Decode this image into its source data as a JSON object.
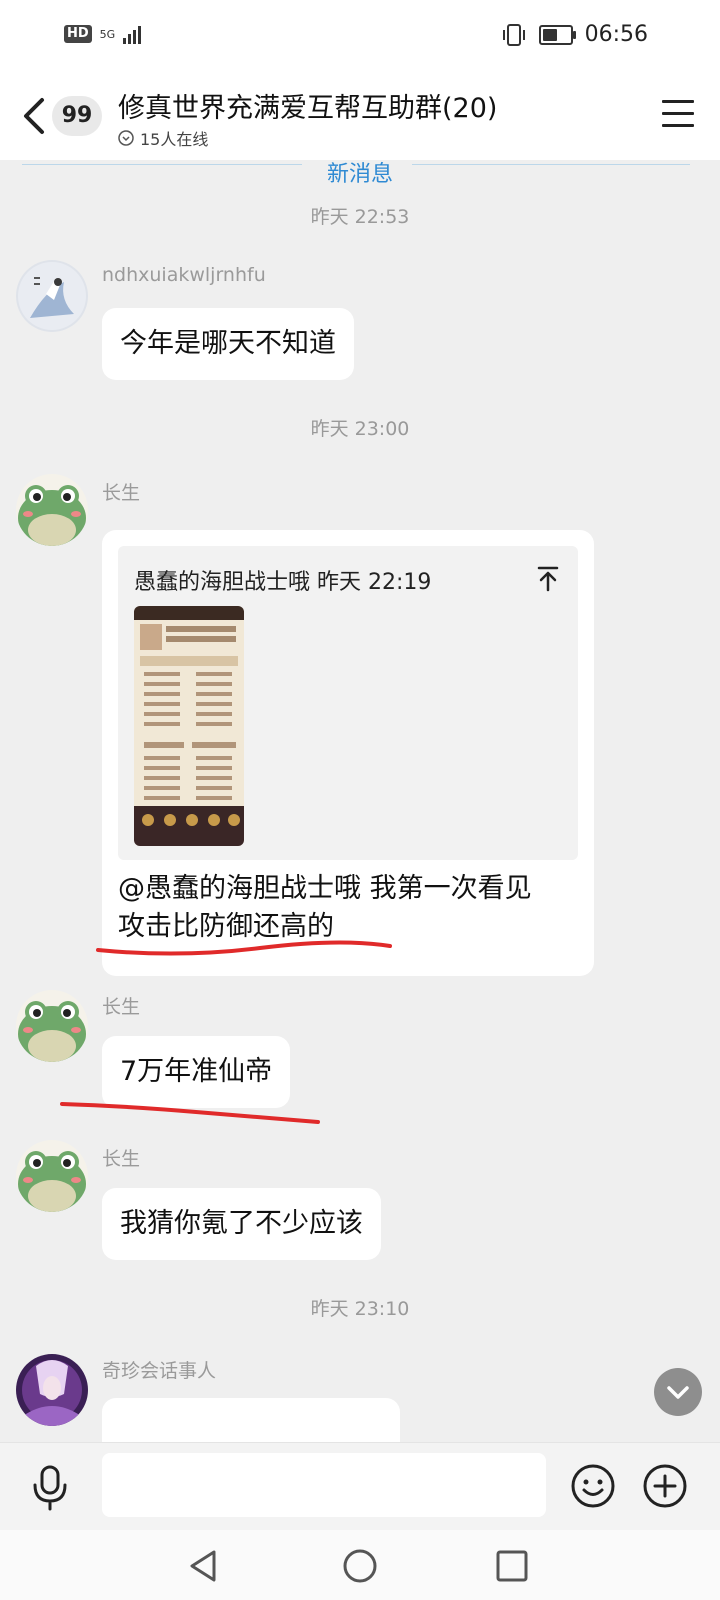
{
  "status_bar": {
    "hd": "HD",
    "network": "5G",
    "battery_level": 0.55,
    "time": "06:56"
  },
  "header": {
    "unread_count": "99",
    "title": "修真世界充满爱互帮互助群(20)",
    "online": "15人在线"
  },
  "chat": {
    "new_messages_label": "新消息",
    "timestamps": [
      "昨天 22:53",
      "昨天 23:00",
      "昨天 23:10"
    ],
    "messages": [
      {
        "sender": "ndhxuiakwljrnhfu",
        "text": "今年是哪天不知道"
      },
      {
        "sender": "长生",
        "quote_header": "愚蠢的海胆战士哦 昨天 22:19",
        "text_line1": "@愚蠢的海胆战士哦 我第一次看见",
        "text_line2": "攻击比防御还高的"
      },
      {
        "sender": "长生",
        "text": "7万年准仙帝"
      },
      {
        "sender": "长生",
        "text": "我猜你氪了不少应该"
      },
      {
        "sender": "奇珍会话事人",
        "text": ""
      }
    ]
  },
  "input": {
    "placeholder": ""
  },
  "colors": {
    "accent": "#2f8ad3",
    "annotation": "#e02a2a",
    "avatar_frog": "#6fa86a"
  },
  "icons": [
    "back-icon",
    "menu-icon",
    "chevron-down-circle-icon",
    "jump-to-message-icon",
    "microphone-icon",
    "emoji-icon",
    "plus-icon",
    "nav-back-icon",
    "nav-home-icon",
    "nav-recents-icon"
  ]
}
